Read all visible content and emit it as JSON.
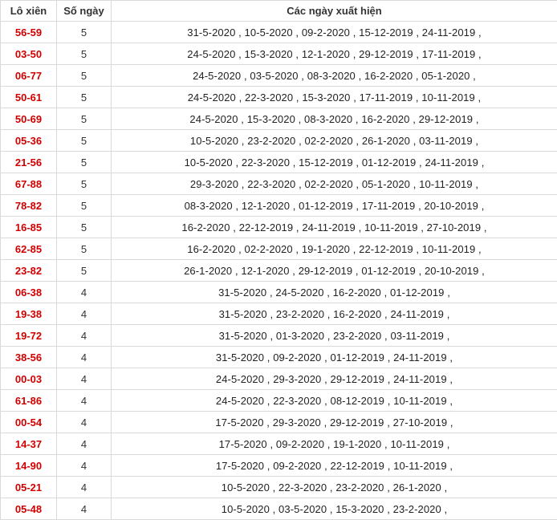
{
  "table": {
    "headers": [
      "Lô xiên",
      "Số ngày",
      "Các ngày xuất hiện"
    ],
    "rows": [
      {
        "pair": "56-59",
        "days": "5",
        "dates": "31-5-2020 , 10-5-2020 , 09-2-2020 , 15-12-2019 , 24-11-2019 ,"
      },
      {
        "pair": "03-50",
        "days": "5",
        "dates": "24-5-2020 , 15-3-2020 , 12-1-2020 , 29-12-2019 , 17-11-2019 ,"
      },
      {
        "pair": "06-77",
        "days": "5",
        "dates": "24-5-2020 , 03-5-2020 , 08-3-2020 , 16-2-2020 , 05-1-2020 ,"
      },
      {
        "pair": "50-61",
        "days": "5",
        "dates": "24-5-2020 , 22-3-2020 , 15-3-2020 , 17-11-2019 , 10-11-2019 ,"
      },
      {
        "pair": "50-69",
        "days": "5",
        "dates": "24-5-2020 , 15-3-2020 , 08-3-2020 , 16-2-2020 , 29-12-2019 ,"
      },
      {
        "pair": "05-36",
        "days": "5",
        "dates": "10-5-2020 , 23-2-2020 , 02-2-2020 , 26-1-2020 , 03-11-2019 ,"
      },
      {
        "pair": "21-56",
        "days": "5",
        "dates": "10-5-2020 , 22-3-2020 , 15-12-2019 , 01-12-2019 , 24-11-2019 ,"
      },
      {
        "pair": "67-88",
        "days": "5",
        "dates": "29-3-2020 , 22-3-2020 , 02-2-2020 , 05-1-2020 , 10-11-2019 ,"
      },
      {
        "pair": "78-82",
        "days": "5",
        "dates": "08-3-2020 , 12-1-2020 , 01-12-2019 , 17-11-2019 , 20-10-2019 ,"
      },
      {
        "pair": "16-85",
        "days": "5",
        "dates": "16-2-2020 , 22-12-2019 , 24-11-2019 , 10-11-2019 , 27-10-2019 ,"
      },
      {
        "pair": "62-85",
        "days": "5",
        "dates": "16-2-2020 , 02-2-2020 , 19-1-2020 , 22-12-2019 , 10-11-2019 ,"
      },
      {
        "pair": "23-82",
        "days": "5",
        "dates": "26-1-2020 , 12-1-2020 , 29-12-2019 , 01-12-2019 , 20-10-2019 ,"
      },
      {
        "pair": "06-38",
        "days": "4",
        "dates": "31-5-2020 , 24-5-2020 , 16-2-2020 , 01-12-2019 ,"
      },
      {
        "pair": "19-38",
        "days": "4",
        "dates": "31-5-2020 , 23-2-2020 , 16-2-2020 , 24-11-2019 ,"
      },
      {
        "pair": "19-72",
        "days": "4",
        "dates": "31-5-2020 , 01-3-2020 , 23-2-2020 , 03-11-2019 ,"
      },
      {
        "pair": "38-56",
        "days": "4",
        "dates": "31-5-2020 , 09-2-2020 , 01-12-2019 , 24-11-2019 ,"
      },
      {
        "pair": "00-03",
        "days": "4",
        "dates": "24-5-2020 , 29-3-2020 , 29-12-2019 , 24-11-2019 ,"
      },
      {
        "pair": "61-86",
        "days": "4",
        "dates": "24-5-2020 , 22-3-2020 , 08-12-2019 , 10-11-2019 ,"
      },
      {
        "pair": "00-54",
        "days": "4",
        "dates": "17-5-2020 , 29-3-2020 , 29-12-2019 , 27-10-2019 ,"
      },
      {
        "pair": "14-37",
        "days": "4",
        "dates": "17-5-2020 , 09-2-2020 , 19-1-2020 , 10-11-2019 ,"
      },
      {
        "pair": "14-90",
        "days": "4",
        "dates": "17-5-2020 , 09-2-2020 , 22-12-2019 , 10-11-2019 ,"
      },
      {
        "pair": "05-21",
        "days": "4",
        "dates": "10-5-2020 , 22-3-2020 , 23-2-2020 , 26-1-2020 ,"
      },
      {
        "pair": "05-48",
        "days": "4",
        "dates": "10-5-2020 , 03-5-2020 , 15-3-2020 , 23-2-2020 ,"
      }
    ]
  },
  "colors": {
    "pair_text": "#d00000",
    "border": "#d9d9d9"
  }
}
